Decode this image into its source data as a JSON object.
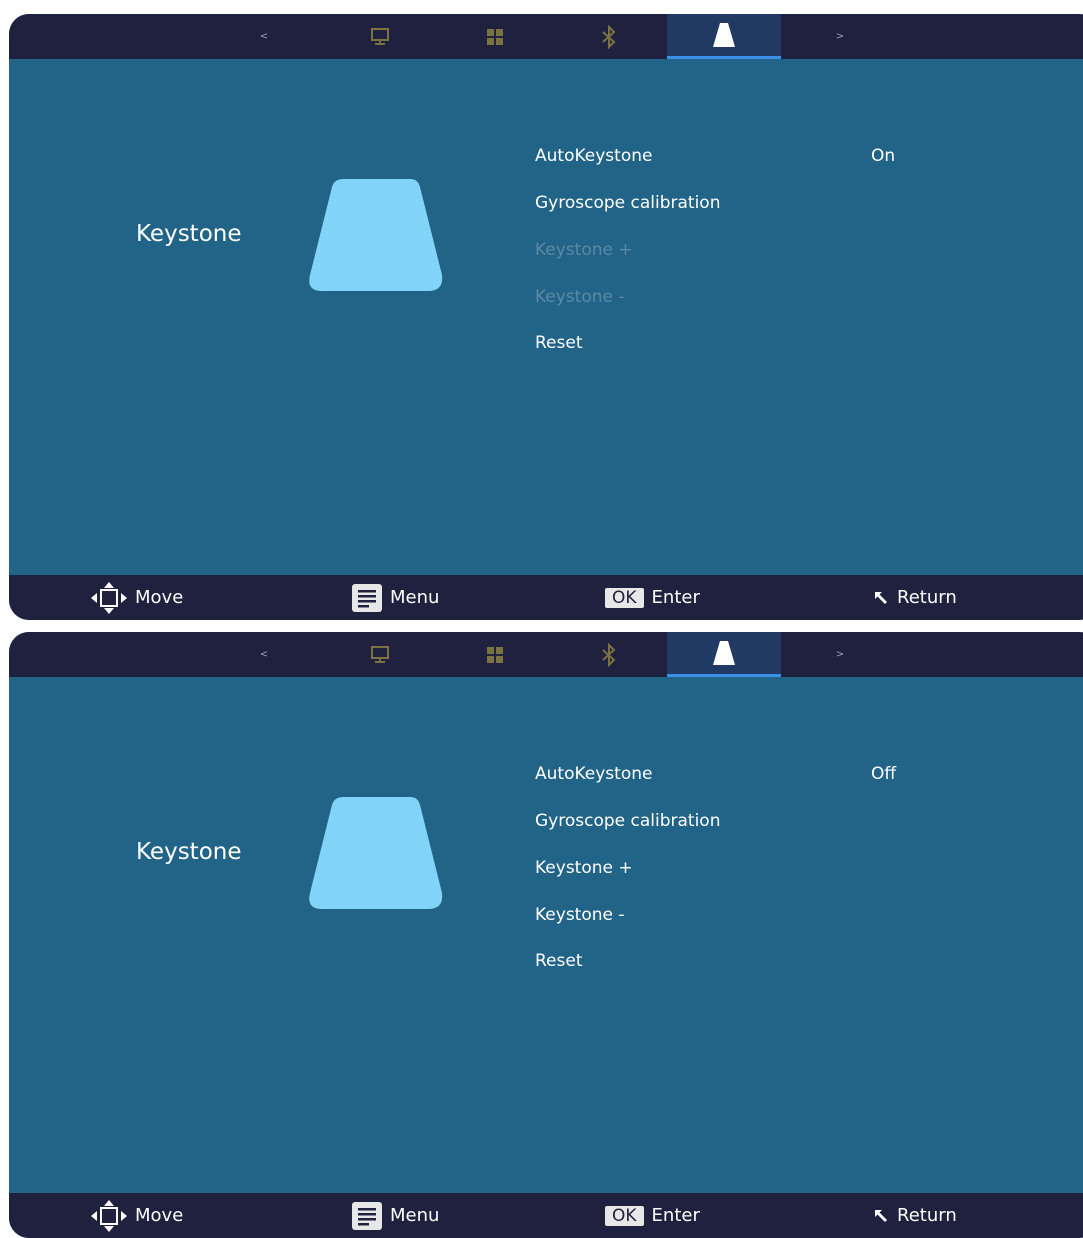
{
  "tabs": {
    "prev_arrow": "<",
    "next_arrow": ">",
    "items": [
      {
        "icon": "monitor-icon"
      },
      {
        "icon": "apps-grid-icon"
      },
      {
        "icon": "bluetooth-icon"
      },
      {
        "icon": "keystone-icon",
        "active": true
      }
    ]
  },
  "colors": {
    "frame_bar": "#20213f",
    "panel_bg": "#226488",
    "active_tab": "#203a63",
    "tab_underline": "#3d8ee6",
    "preview_shape": "#81d4f7",
    "inactive_icon": "#7a7240",
    "disabled_text": "#5a8aa5"
  },
  "panels": [
    {
      "section_title": "Keystone",
      "items": [
        {
          "label": "AutoKeystone",
          "value": "On",
          "enabled": true
        },
        {
          "label": "Gyroscope calibration",
          "enabled": true
        },
        {
          "label": "Keystone +",
          "enabled": false
        },
        {
          "label": "Keystone -",
          "enabled": false
        },
        {
          "label": "Reset",
          "enabled": true
        }
      ]
    },
    {
      "section_title": "Keystone",
      "items": [
        {
          "label": "AutoKeystone",
          "value": "Off",
          "enabled": true
        },
        {
          "label": "Gyroscope calibration",
          "enabled": true
        },
        {
          "label": "Keystone +",
          "enabled": true
        },
        {
          "label": "Keystone -",
          "enabled": true
        },
        {
          "label": "Reset",
          "enabled": true
        }
      ]
    }
  ],
  "footer": {
    "move": "Move",
    "menu": "Menu",
    "ok_key": "OK",
    "enter": "Enter",
    "return": "Return"
  }
}
